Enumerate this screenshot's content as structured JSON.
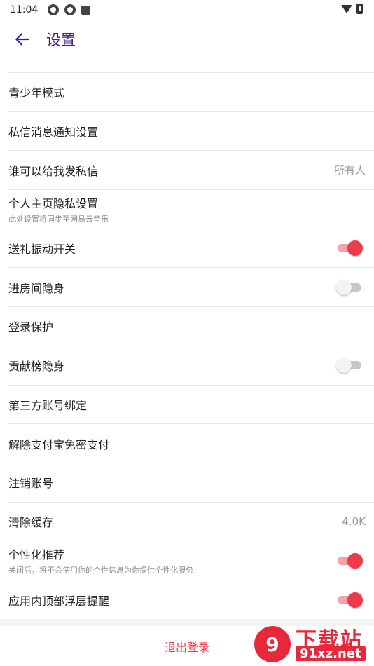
{
  "status_bar": {
    "time": "11:04"
  },
  "header": {
    "title": "设置"
  },
  "settings": [
    {
      "label": "青少年模式"
    },
    {
      "label": "私信消息通知设置"
    },
    {
      "label": "谁可以给我发私信",
      "value": "所有人"
    },
    {
      "label": "个人主页隐私设置",
      "sub": "此处设置将同步至网易云音乐"
    },
    {
      "label": "送礼振动开关",
      "toggle": "on"
    },
    {
      "label": "进房间隐身",
      "toggle": "off"
    },
    {
      "label": "登录保护"
    },
    {
      "label": "贡献榜隐身",
      "toggle": "off"
    },
    {
      "label": "第三方账号绑定"
    },
    {
      "label": "解除支付宝免密支付"
    },
    {
      "label": "注销账号"
    },
    {
      "label": "清除缓存",
      "value": "4.0K"
    },
    {
      "label": "个性化推荐",
      "sub": "关闭后，将不会使用你的个性信息为你提供个性化服务",
      "toggle": "on"
    },
    {
      "label": "应用内顶部浮层提醒",
      "toggle": "on"
    }
  ],
  "footer": {
    "logout_label": "退出登录"
  },
  "watermark": {
    "top_text": "下载站",
    "bottom_text": "91xz.net"
  },
  "colors": {
    "accent": "#ee3b4b",
    "title": "#3f1d8a"
  }
}
